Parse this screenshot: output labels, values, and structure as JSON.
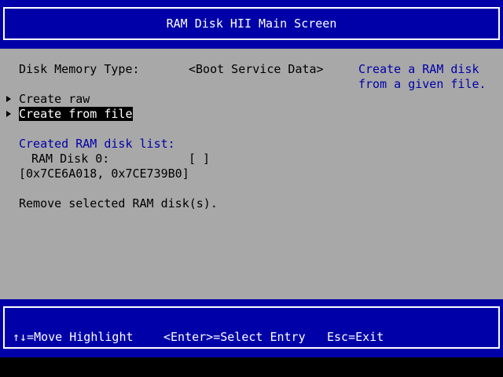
{
  "header": {
    "title": "RAM Disk HII Main Screen"
  },
  "main": {
    "disk_memory_type_label": "Disk Memory Type:",
    "disk_memory_type_value": "<Boot Service Data>",
    "help_text_line1": "Create a RAM disk",
    "help_text_line2": "from a given file.",
    "create_raw_label": "Create raw",
    "create_from_file_label": "Create from file",
    "created_list_heading": "Created RAM disk list:",
    "ram_disk_0_label": "RAM Disk 0:",
    "ram_disk_0_checkbox": "[ ]",
    "ram_disk_0_range": "[0x7CE6A018, 0x7CE739B0]",
    "remove_label": "Remove selected RAM disk(s)."
  },
  "footer": {
    "move_highlight": "↑↓=Move Highlight",
    "select_entry": "<Enter>=Select Entry",
    "exit": "Esc=Exit"
  },
  "colors": {
    "blue": "#0000a8",
    "grey": "#a8a8a8",
    "white": "#ffffff",
    "black": "#000000"
  }
}
